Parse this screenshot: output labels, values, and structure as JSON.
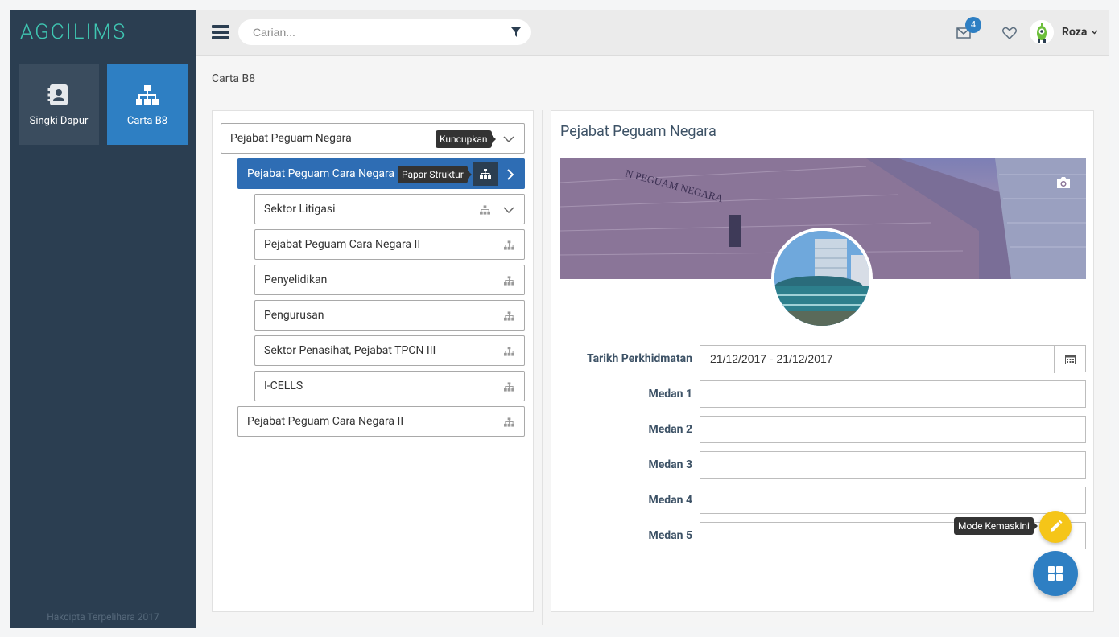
{
  "app": {
    "logo": "AGCILIMS",
    "copyright": "Hakcipta Terpelihara 2017"
  },
  "sidebar": {
    "items": [
      {
        "label": "Singki Dapur",
        "icon": "address-book-icon",
        "active": false
      },
      {
        "label": "Carta B8",
        "icon": "org-chart-icon",
        "active": true
      }
    ]
  },
  "topbar": {
    "search_placeholder": "Carian...",
    "mail_count": "4",
    "username": "Roza"
  },
  "breadcrumb": "Carta B8",
  "tree": {
    "root": {
      "label": "Pejabat Peguam Negara",
      "tooltip": "Kuncupkan"
    },
    "active": {
      "label": "Pejabat Peguam Cara Negara",
      "tooltip": "Papar Struktur"
    },
    "children": [
      {
        "label": "Sektor Litigasi"
      },
      {
        "label": "Pejabat Peguam Cara Negara II"
      },
      {
        "label": "Penyelidikan"
      },
      {
        "label": "Pengurusan"
      },
      {
        "label": "Sektor Penasihat, Pejabat TPCN III"
      },
      {
        "label": "I-CELLS"
      }
    ],
    "sibling": {
      "label": "Pejabat Peguam Cara Negara II"
    }
  },
  "detail": {
    "title": "Pejabat Peguam Negara",
    "fields": [
      {
        "label": "Tarikh Perkhidmatan",
        "value": "21/12/2017 - 21/12/2017"
      },
      {
        "label": "Medan 1",
        "value": ""
      },
      {
        "label": "Medan 2",
        "value": ""
      },
      {
        "label": "Medan 3",
        "value": ""
      },
      {
        "label": "Medan 4",
        "value": ""
      },
      {
        "label": "Medan 5",
        "value": ""
      }
    ],
    "edit_tooltip": "Mode Kemaskini"
  },
  "colors": {
    "sidebar": "#2b3e51",
    "accent": "#2e7fc3",
    "logo": "#3fc6b2",
    "edit_fab": "#f5c518"
  }
}
